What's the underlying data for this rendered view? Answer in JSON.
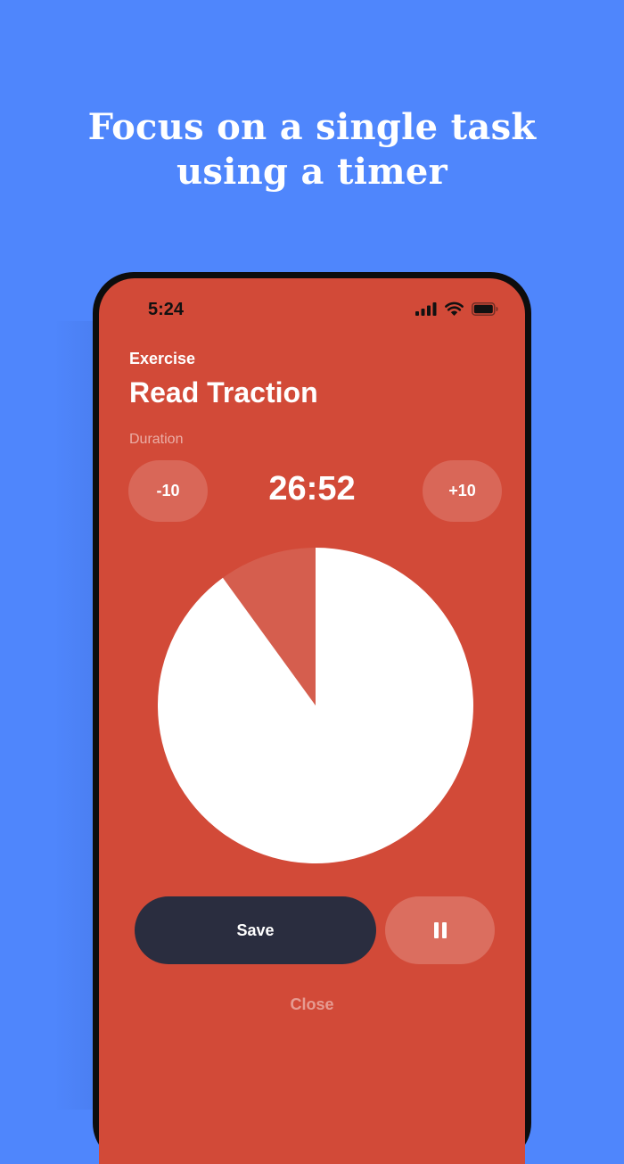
{
  "promo": {
    "headline_line1": "Focus on a single task",
    "headline_line2": "using a timer"
  },
  "status_bar": {
    "time": "5:24",
    "icons": [
      "signal-icon",
      "wifi-icon",
      "battery-icon"
    ]
  },
  "task": {
    "category": "Exercise",
    "title": "Read Traction"
  },
  "duration": {
    "label": "Duration",
    "decrease_label": "-10",
    "increase_label": "+10",
    "time_display": "26:52"
  },
  "progress": {
    "remaining_fraction": 0.9
  },
  "actions": {
    "save_label": "Save",
    "pause_icon": "pause-icon",
    "close_label": "Close"
  },
  "colors": {
    "background": "#4f86fc",
    "screen": "#d24a38",
    "pie_remaining": "#ffffff",
    "pie_elapsed": "#d55e4e",
    "save_button": "#2a2d3f"
  }
}
